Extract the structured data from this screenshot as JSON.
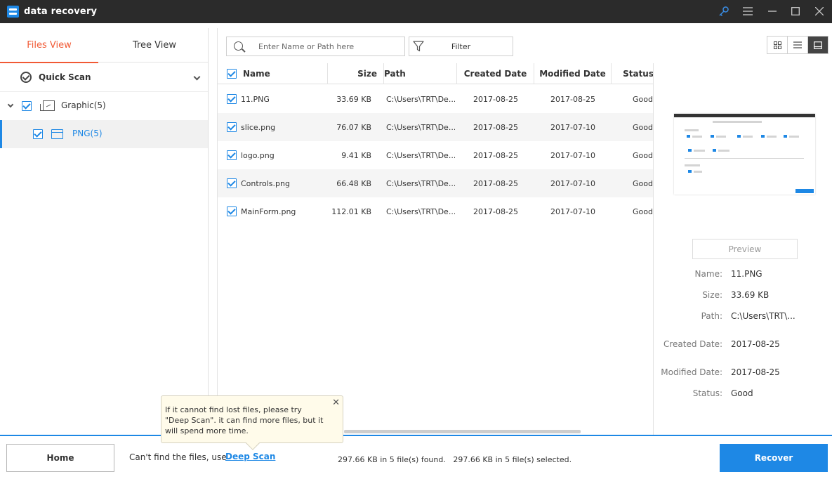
{
  "window": {
    "title": "data recovery"
  },
  "sidebar": {
    "tabs": [
      "Files View",
      "Tree View"
    ],
    "scan_label": "Quick Scan",
    "tree": [
      {
        "label": "Graphic(5)"
      },
      {
        "label": "PNG(5)"
      }
    ]
  },
  "toolbar": {
    "search_placeholder": "Enter Name or Path here",
    "filter_label": "Filter"
  },
  "table": {
    "headers": {
      "name": "Name",
      "size": "Size",
      "path": "Path",
      "created": "Created Date",
      "modified": "Modified Date",
      "status": "Status"
    },
    "rows": [
      {
        "name": "11.PNG",
        "size": "33.69 KB",
        "path": "C:\\Users\\TRT\\De...",
        "created": "2017-08-25",
        "modified": "2017-08-25",
        "status": "Good"
      },
      {
        "name": "slice.png",
        "size": "76.07 KB",
        "path": "C:\\Users\\TRT\\De...",
        "created": "2017-08-25",
        "modified": "2017-07-10",
        "status": "Good"
      },
      {
        "name": "logo.png",
        "size": "9.41 KB",
        "path": "C:\\Users\\TRT\\De...",
        "created": "2017-08-25",
        "modified": "2017-07-10",
        "status": "Good"
      },
      {
        "name": "Controls.png",
        "size": "66.48 KB",
        "path": "C:\\Users\\TRT\\De...",
        "created": "2017-08-25",
        "modified": "2017-07-10",
        "status": "Good"
      },
      {
        "name": "MainForm.png",
        "size": "112.01 KB",
        "path": "C:\\Users\\TRT\\De...",
        "created": "2017-08-25",
        "modified": "2017-07-10",
        "status": "Good"
      }
    ]
  },
  "preview": {
    "button_label": "Preview",
    "labels": {
      "name": "Name:",
      "size": "Size:",
      "path": "Path:",
      "created": "Created Date:",
      "modified": "Modified Date:",
      "status": "Status:"
    },
    "values": {
      "name": "11.PNG",
      "size": "33.69 KB",
      "path": "C:\\Users\\TRT\\...",
      "created": "2017-08-25",
      "modified": "2017-08-25",
      "status": "Good"
    }
  },
  "tooltip": {
    "text": "If it cannot find lost files, please try \"Deep Scan\". it can find more files, but it will spend more time."
  },
  "footer": {
    "home_label": "Home",
    "cant_find_text": "Can't find the files, use",
    "deep_scan_label": "Deep Scan",
    "status_text": "297.66 KB in 5 file(s) found.   297.66 KB in 5 file(s) selected.",
    "recover_label": "Recover"
  },
  "colors": {
    "accent": "#1e88e5",
    "tab_active": "#f15a35",
    "titlebar": "#2b2b2b"
  }
}
